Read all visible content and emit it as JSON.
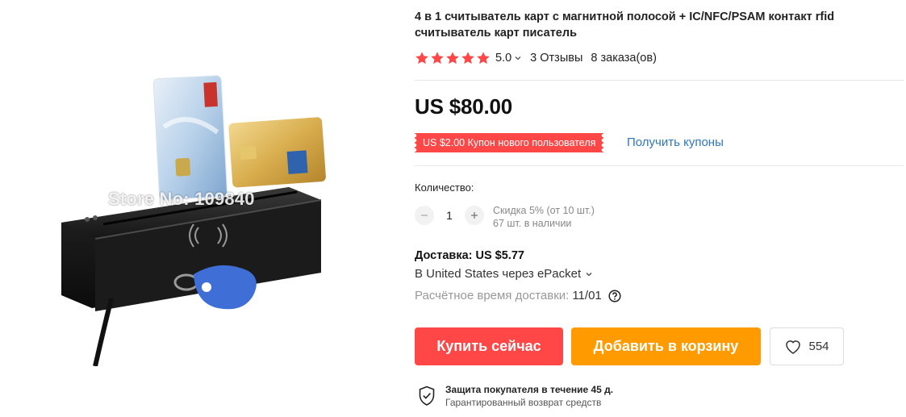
{
  "product": {
    "image_watermark": "Store No: 109840",
    "title": "4 в 1 считыватель карт с магнитной полосой + IC/NFC/PSAM контакт rfid считыватель карт писатель",
    "rating": {
      "stars": 5,
      "value": "5.0",
      "reviews": "3 Отзывы",
      "orders": "8 заказа(ов)",
      "star_color": "#ff4747"
    },
    "price": "US $80.00",
    "coupon": {
      "badge": "US $2.00 Купон нового пользователя",
      "link": "Получить купоны",
      "badge_color": "#ff4747",
      "link_color": "#2e77bd"
    },
    "quantity": {
      "label": "Количество:",
      "value": "1",
      "decrement_icon": "minus-icon",
      "increment_icon": "plus-icon",
      "discount": "Скидка 5% (от 10 шт.)",
      "stock": "67 шт. в наличии"
    },
    "shipping": {
      "title": "Доставка: US $5.77",
      "method": "В United States через ePacket",
      "time_label": "Расчётное время доставки:",
      "time_value": "11/01",
      "help_icon": "question-circle-icon"
    },
    "actions": {
      "buy_now": "Купить сейчас",
      "add_to_cart": "Добавить в корзину",
      "wishlist_count": "554",
      "buy_color": "#ff4747",
      "cart_color": "#ff9a00",
      "wishlist_icon": "heart-icon"
    },
    "protection": {
      "title": "Защита покупателя в течение 45 д.",
      "subtitle": "Гарантированный возврат средств",
      "icon": "shield-check-icon"
    }
  }
}
